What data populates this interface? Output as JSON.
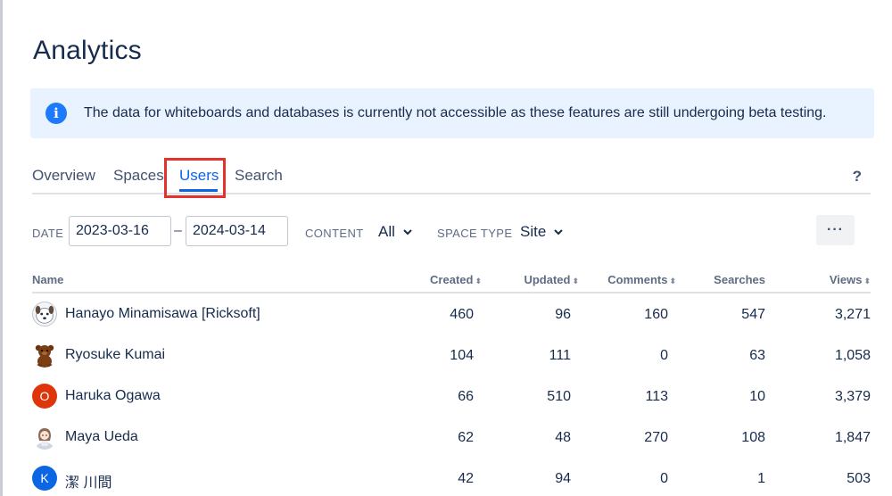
{
  "page": {
    "title": "Analytics"
  },
  "banner": {
    "text": "The data for whiteboards and databases is currently not accessible as these features are still undergoing beta testing."
  },
  "tabs": [
    {
      "label": "Overview"
    },
    {
      "label": "Spaces"
    },
    {
      "label": "Users",
      "active": true
    },
    {
      "label": "Search"
    }
  ],
  "help": {
    "label": "?"
  },
  "filters": {
    "date_label": "DATE",
    "date_from": "2023-03-16",
    "date_sep": "–",
    "date_to": "2024-03-14",
    "content_label": "CONTENT",
    "content_value": "All",
    "space_type_label": "SPACE TYPE",
    "space_type_value": "Site",
    "more_label": "···"
  },
  "table": {
    "headers": {
      "name": "Name",
      "created": "Created",
      "updated": "Updated",
      "comments": "Comments",
      "searches": "Searches",
      "views": "Views"
    },
    "rows": [
      {
        "name": "Hanayo Minamisawa [Ricksoft]",
        "avatar": "dog-face-avatar",
        "created": "460",
        "updated": "96",
        "comments": "160",
        "searches": "547",
        "views": "3,271"
      },
      {
        "name": "Ryosuke Kumai",
        "avatar": "bear-avatar",
        "created": "104",
        "updated": "111",
        "comments": "0",
        "searches": "63",
        "views": "1,058"
      },
      {
        "name": "Haruka Ogawa",
        "avatar": "initial-avatar",
        "initial": "O",
        "avatar_color": "#de350b",
        "created": "66",
        "updated": "510",
        "comments": "113",
        "searches": "10",
        "views": "3,379"
      },
      {
        "name": "Maya Ueda",
        "avatar": "person-illustration-avatar",
        "created": "62",
        "updated": "48",
        "comments": "270",
        "searches": "108",
        "views": "1,847"
      },
      {
        "name": "潔 川間",
        "avatar": "initial-avatar",
        "initial": "K",
        "avatar_color": "#0c66e4",
        "created": "42",
        "updated": "94",
        "comments": "0",
        "searches": "1",
        "views": "503"
      }
    ]
  },
  "colors": {
    "accent": "#0c66e4",
    "highlight": "#e5312b",
    "banner_bg": "#e9f2ff",
    "info_icon": "#1d7afc"
  }
}
